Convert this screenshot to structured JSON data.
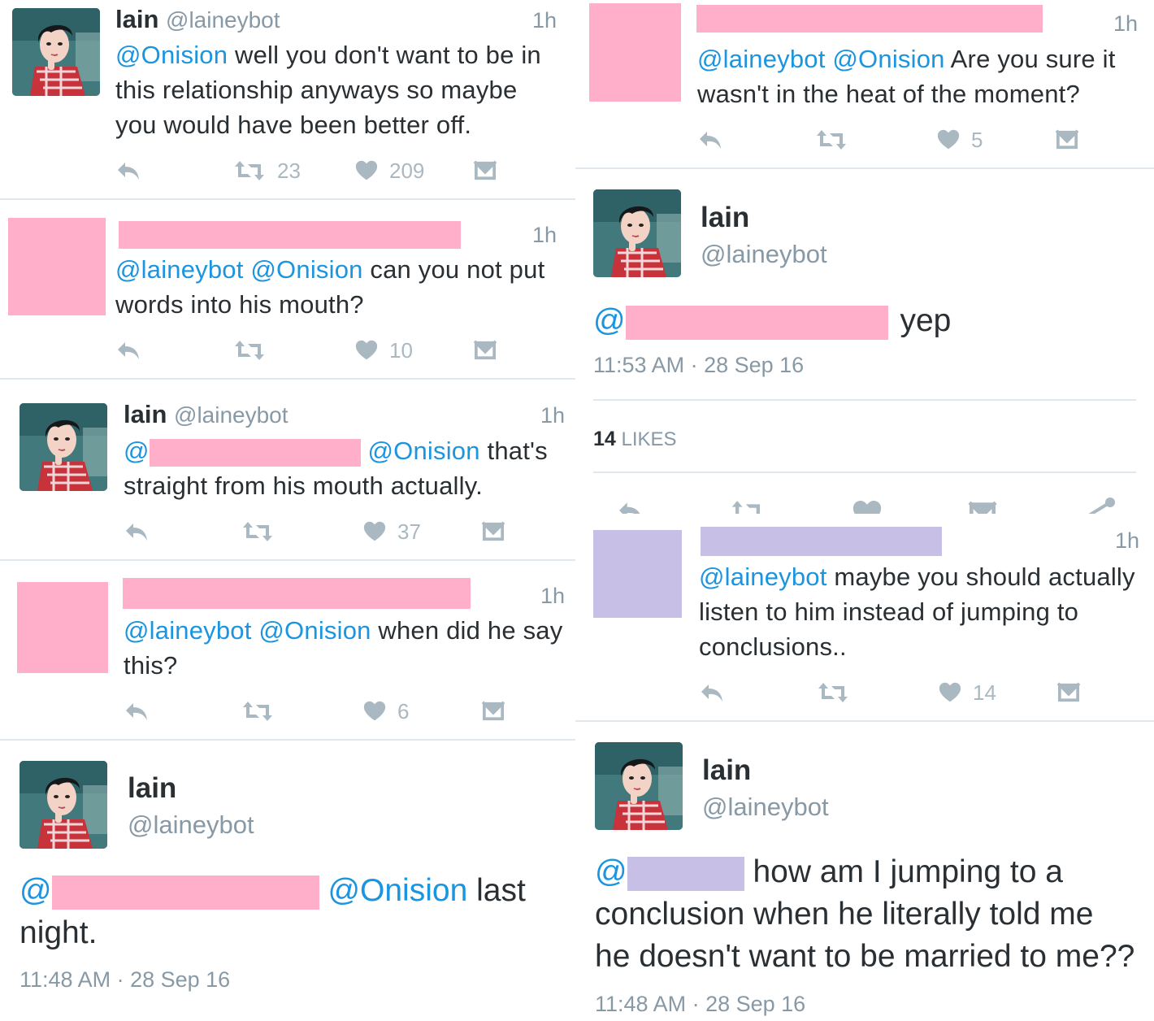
{
  "left": {
    "tweet1": {
      "name": "lain",
      "handle": "@laineybot",
      "time": "1h",
      "mention": "@Onision",
      "text_l1": " well you don't want to be in",
      "text_l2": "this relationship anyways so maybe",
      "text_l3": "you would have been better off.",
      "retweets": "23",
      "likes": "209"
    },
    "tweet2": {
      "time": "1h",
      "mention1": "@laineybot",
      "mention2": "@Onision",
      "text_l1": " can you not put",
      "text_l2": "words into his mouth?",
      "likes": "10"
    },
    "tweet3": {
      "name": "lain",
      "handle": "@laineybot",
      "time": "1h",
      "at": "@",
      "mention2": "@Onision",
      "text_l1": " that's",
      "text_l2": "straight from his mouth actually.",
      "likes": "37"
    },
    "tweet4": {
      "time": "1h",
      "mention1": "@laineybot",
      "mention2": "@Onision",
      "text_l1": " when did he say",
      "text_l2": "this?",
      "likes": "6"
    },
    "tweet5": {
      "name": "lain",
      "handle": "@laineybot",
      "at": "@",
      "mention2": "@Onision",
      "text_l1": " last",
      "text_l2": "night.",
      "timestamp": "11:48 AM · 28 Sep 16"
    }
  },
  "right": {
    "tweet1": {
      "time": "1h",
      "mention1": "@laineybot",
      "mention2": "@Onision",
      "text_l1": " Are you sure it",
      "text_l2": "wasn't in the heat of the moment?",
      "likes": "5"
    },
    "tweet2": {
      "name": "lain",
      "handle": "@laineybot",
      "at": "@",
      "text": "yep",
      "timestamp": "11:53 AM · 28 Sep 16",
      "likes_count": "14",
      "likes_label": "LIKES"
    },
    "tweet3": {
      "time": "1h",
      "mention1": "@laineybot",
      "text_l1": " maybe you should actually",
      "text_l2": "listen to him instead of jumping to",
      "text_l3": "conclusions..",
      "likes": "14"
    },
    "tweet4": {
      "name": "lain",
      "handle": "@laineybot",
      "at": "@",
      "text_l1": "how am I jumping to a",
      "text_l2": "conclusion when he literally told me",
      "text_l3": "he doesn't want to be married to me??",
      "timestamp": "11:48 AM · 28 Sep 16"
    }
  },
  "colors": {
    "mention": "#1b95e0",
    "redaction_pink": "#ffafca",
    "redaction_lavender": "#c8bfe6",
    "muted": "#8899a6",
    "icon": "#aab8c2"
  },
  "icons": [
    "reply-icon",
    "retweet-icon",
    "heart-icon",
    "message-icon",
    "share-icon"
  ]
}
